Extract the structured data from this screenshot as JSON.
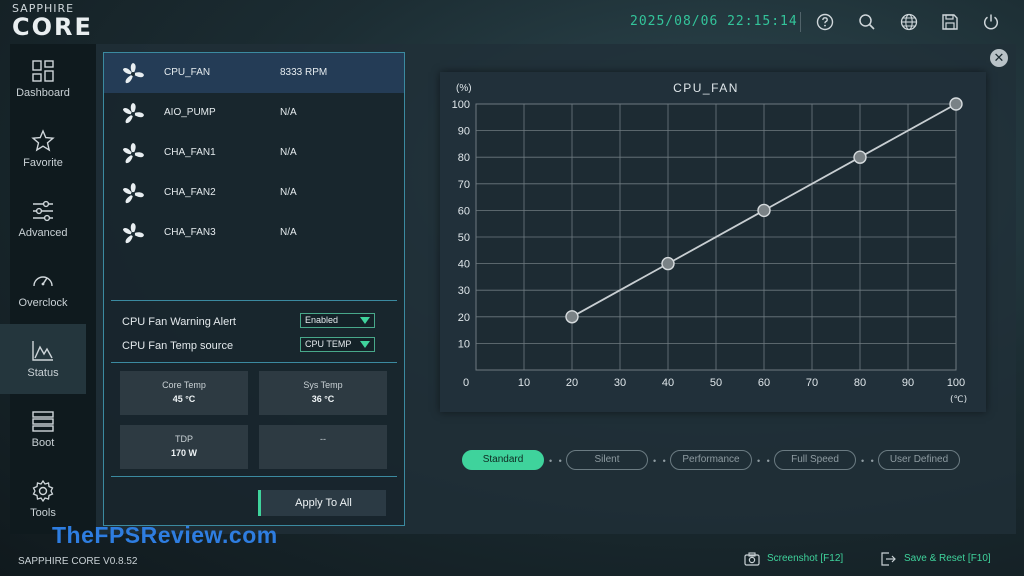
{
  "brand": {
    "top": "SAPPHIRE",
    "core": "CORE"
  },
  "header": {
    "datetime": "2025/08/06 22:15:14",
    "icons": [
      "help-icon",
      "search-icon",
      "globe-icon",
      "save-icon",
      "power-icon"
    ]
  },
  "sidebar": {
    "items": [
      {
        "label": "Dashboard",
        "icon": "dashboard-icon"
      },
      {
        "label": "Favorite",
        "icon": "star-icon"
      },
      {
        "label": "Advanced",
        "icon": "sliders-icon"
      },
      {
        "label": "Overclock",
        "icon": "gauge-icon"
      },
      {
        "label": "Status",
        "icon": "status-chart-icon",
        "active": true
      },
      {
        "label": "Boot",
        "icon": "boot-icon"
      },
      {
        "label": "Tools",
        "icon": "gear-icon"
      }
    ]
  },
  "fans": [
    {
      "name": "CPU_FAN",
      "value": "8333 RPM",
      "selected": true
    },
    {
      "name": "AIO_PUMP",
      "value": "N/A"
    },
    {
      "name": "CHA_FAN1",
      "value": "N/A"
    },
    {
      "name": "CHA_FAN2",
      "value": "N/A"
    },
    {
      "name": "CHA_FAN3",
      "value": "N/A"
    }
  ],
  "options": {
    "warning_label": "CPU Fan Warning Alert",
    "warning_value": "Enabled",
    "temp_source_label": "CPU Fan Temp source",
    "temp_source_value": "CPU TEMP"
  },
  "stats": {
    "core_temp_label": "Core Temp",
    "core_temp_value": "45 °C",
    "sys_temp_label": "Sys Temp",
    "sys_temp_value": "36 °C",
    "tdp_label": "TDP",
    "tdp_value": "170 W",
    "empty_value": "--"
  },
  "apply_label": "Apply To All",
  "chart_data": {
    "type": "line",
    "title": "CPU_FAN",
    "xlabel": "(℃)",
    "ylabel": "(%)",
    "xlim": [
      0,
      100
    ],
    "ylim": [
      0,
      100
    ],
    "x_ticks": [
      0,
      10,
      20,
      30,
      40,
      50,
      60,
      70,
      80,
      90,
      100
    ],
    "y_ticks": [
      10,
      20,
      30,
      40,
      50,
      60,
      70,
      80,
      90,
      100
    ],
    "grid": true,
    "series": [
      {
        "x": [
          20,
          40,
          60,
          80,
          100
        ],
        "y": [
          20,
          40,
          60,
          80,
          100
        ]
      }
    ],
    "colors": {
      "line": "#c8ced2",
      "point": "#7a8286",
      "grid": "#6e7a80"
    }
  },
  "modes": [
    {
      "label": "Standard",
      "active": true
    },
    {
      "label": "Silent"
    },
    {
      "label": "Performance"
    },
    {
      "label": "Full Speed"
    },
    {
      "label": "User Defined"
    }
  ],
  "footer": {
    "version": "SAPPHIRE CORE V0.8.52",
    "screenshot": "Screenshot [F12]",
    "save_reset": "Save & Reset [F10]",
    "watermark": "TheFPSReview.com"
  },
  "accent": "#3fd39c"
}
